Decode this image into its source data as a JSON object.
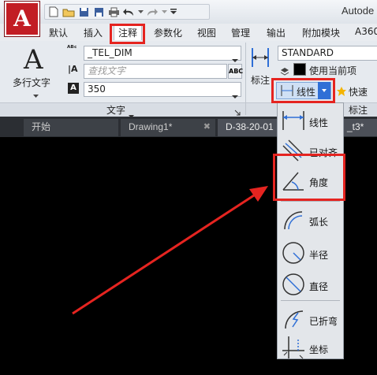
{
  "window": {
    "title": "Autode",
    "logo_letter": "A"
  },
  "ribbon_tabs": [
    "默认",
    "插入",
    "注释",
    "参数化",
    "视图",
    "管理",
    "输出",
    "附加模块",
    "A360"
  ],
  "text_panel": {
    "multiline_text_label": "多行文字",
    "style_value": "_TEL_DIM",
    "find_placeholder": "查找文字",
    "height_value": "350",
    "panel_label": "文字"
  },
  "dimension_panel": {
    "dim_label": "标注",
    "style_value": "STANDARD",
    "use_current_label": "使用当前项",
    "linear_button_label": "线性",
    "quick_label": "快速",
    "panel_label": "标注"
  },
  "document_tabs": [
    {
      "label": "开始"
    },
    {
      "label": "Drawing1*"
    },
    {
      "label": "D-38-20-01"
    },
    {
      "label": "_t3*"
    }
  ],
  "dropdown_items": [
    {
      "label": "线性"
    },
    {
      "label": "已对齐"
    },
    {
      "label": "角度"
    },
    {
      "label": "弧长"
    },
    {
      "label": "半径"
    },
    {
      "label": "直径"
    },
    {
      "label": "已折弯"
    },
    {
      "label": "坐标"
    }
  ],
  "colors": {
    "highlight": "#e52420",
    "accent_blue": "#2f6fd6",
    "canvas": "#000000"
  }
}
